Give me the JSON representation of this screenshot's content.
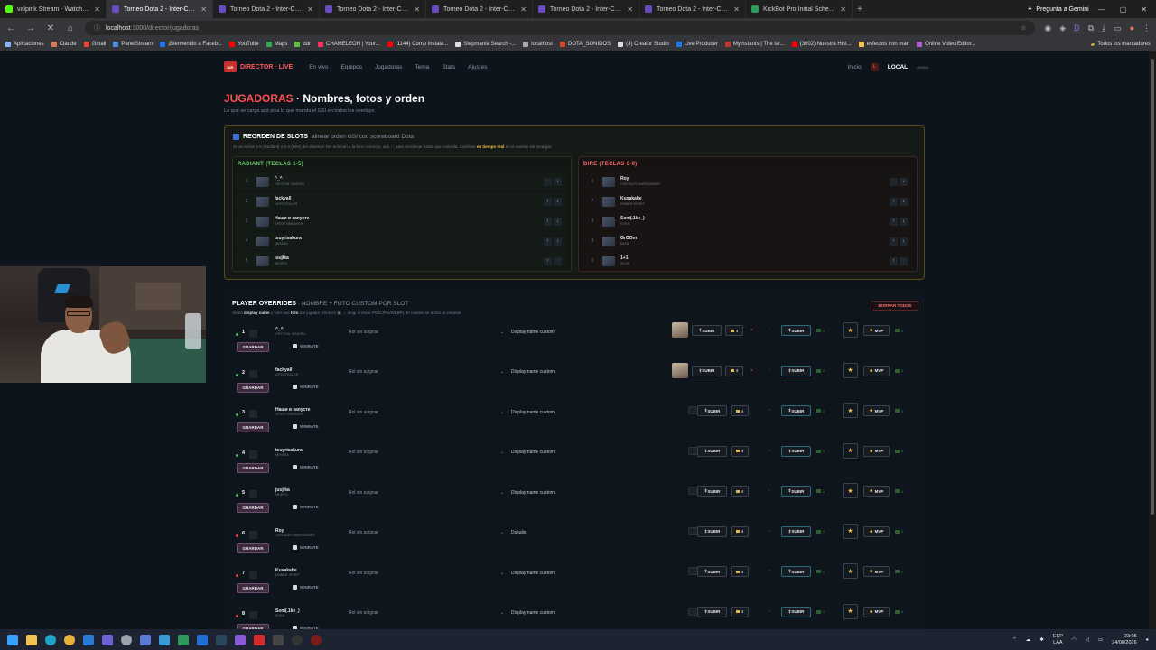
{
  "browser": {
    "tabs": [
      {
        "title": "valpink Stream - Watch Live",
        "fav": "#53fc18",
        "active": false
      },
      {
        "title": "Torneo Dota 2 - Inter-Comunid",
        "fav": "#6a4cc0",
        "active": true
      },
      {
        "title": "Torneo Dota 2 - Inter-Comunid",
        "fav": "#6a4cc0",
        "active": false
      },
      {
        "title": "Torneo Dota 2 - Inter-Comunid",
        "fav": "#6a4cc0",
        "active": false
      },
      {
        "title": "Torneo Dota 2 - Inter-Comunid",
        "fav": "#6a4cc0",
        "active": false
      },
      {
        "title": "Torneo Dota 2 - Inter-Comunid",
        "fav": "#6a4cc0",
        "active": false
      },
      {
        "title": "Torneo Dota 2 - Inter-Comunid",
        "fav": "#6a4cc0",
        "active": false
      },
      {
        "title": "KickBot Pro Initial Schema | SC",
        "fav": "#2e9a5e",
        "active": false
      }
    ],
    "gemini_label": "Pregunta a Gemini",
    "url_host": "localhost",
    "url_path": ":3000/director/jugadoras",
    "bookmarks": [
      {
        "label": "Aplicaciones",
        "color": "#8ab4f8"
      },
      {
        "label": "Claude",
        "color": "#d97757"
      },
      {
        "label": "Gmail",
        "color": "#ea4335"
      },
      {
        "label": "PanelStream",
        "color": "#4a90e2"
      },
      {
        "label": "¡Bienvenido a Faceb...",
        "color": "#1877f2"
      },
      {
        "label": "YouTube",
        "color": "#ff0000"
      },
      {
        "label": "Maps",
        "color": "#34a853"
      },
      {
        "label": "ddr",
        "color": "#5fbf3f"
      },
      {
        "label": "CHAMELEON | Your...",
        "color": "#ff3366"
      },
      {
        "label": "(1144) Como instala...",
        "color": "#ff0000"
      },
      {
        "label": "Stepmania Search -...",
        "color": "#dddddd"
      },
      {
        "label": "localhost",
        "color": "#aaaaaa"
      },
      {
        "label": "DOTA_SONIDOS",
        "color": "#d04a2a"
      },
      {
        "label": "(3) Creator Studio",
        "color": "#dddddd"
      },
      {
        "label": "Live Producer",
        "color": "#1877f2"
      },
      {
        "label": "Myinstants | The lar...",
        "color": "#c0392b"
      },
      {
        "label": "(3002) Nuestra Hist...",
        "color": "#ff0000"
      },
      {
        "label": "evfectos iron man",
        "color": "#f2c14e"
      },
      {
        "label": "Online Video Editor...",
        "color": "#b45fd6"
      }
    ],
    "bookmarks_all": "Todos los marcadores"
  },
  "app": {
    "brand": "DIRECTOR · LIVE",
    "nav": [
      "En vivo",
      "Equipos",
      "Jugadoras",
      "Tema",
      "Stats",
      "Ajustes"
    ],
    "inicio": "Inicio",
    "local_badge": "L",
    "local": "LOCAL",
    "admin": "ADMIN"
  },
  "header": {
    "title_red": "JUGADORAS",
    "title_rest": "· Nombres, fotos y orden",
    "subtitle": "Lo que se carga acá pisa lo que manda el GSI en todos los overlays."
  },
  "reorder": {
    "title": "REORDEN DE SLOTS",
    "note": "alinear orden GSI con scoreboard Dota",
    "desc_a": "Si las teclas 1-5 (Radiant) o 6-0 (Dire) del observer NO enfocan a la hero correcto, usá ↑↓ para reordenar hasta que coincida. Cambios",
    "desc_b": "en tiempo real",
    "desc_c": "en el overlay sin recargar.",
    "radiant_title": "RADIANT (TECLAS 1-5)",
    "dire_title": "DIRE (TECLAS 6-0)",
    "radiant": [
      {
        "n": "1",
        "player": "^_^",
        "hero": "CRYSTAL MAIDEN",
        "up": false,
        "down": true
      },
      {
        "n": "2",
        "player": "fackyall",
        "hero": "LIFESTEALER",
        "up": true,
        "down": true
      },
      {
        "n": "3",
        "player": "Наши в капусте",
        "hero": "SPIRIT BREAKER",
        "up": true,
        "down": true
      },
      {
        "n": "4",
        "player": "tsuyrisakura",
        "hero": "MIRANA",
        "up": true,
        "down": true
      },
      {
        "n": "5",
        "player": "juujika",
        "hero": "MEEPO",
        "up": true,
        "down": false
      }
    ],
    "dire": [
      {
        "n": "6",
        "player": "Roy",
        "hero": "CENTAUR WARRUNNER",
        "up": false,
        "down": true
      },
      {
        "n": "7",
        "player": "Kusakabe",
        "hero": "EMBER SPIRIT",
        "up": true,
        "down": true
      },
      {
        "n": "8",
        "player": "Soni(.1ke_)",
        "hero": "SVEN",
        "up": true,
        "down": true
      },
      {
        "n": "9",
        "player": "GrOOm",
        "hero": "BANE",
        "up": true,
        "down": true
      },
      {
        "n": "0",
        "player": "1+1",
        "hero": "ZEUS",
        "up": true,
        "down": false
      }
    ]
  },
  "overrides": {
    "title": "PLAYER OVERRIDES",
    "subtitle": "· NOMBRE + FOTO CUSTOM POR SLOT",
    "desc_a": "Setéá",
    "desc_b": "display name",
    "desc_c": "y subí una",
    "desc_d": "foto",
    "desc_e": "por jugador (click en",
    "desc_f": "→ elegí archivo PNG/JPG/WEBP). El cambio se aplica al instante.",
    "clear_all": "BORRAR TODOS",
    "role_placeholder": "Rol sin asignar",
    "display_placeholder": "Display name custom",
    "subir": "SUBIR",
    "count": "4",
    "mvp": "MVP",
    "zero": "0",
    "guardar": "GUARDAR",
    "winrate": "WINRATE",
    "rows": [
      {
        "slot": "1",
        "player": "^_^",
        "hero": "CRYSTAL MAIDEN",
        "display": "",
        "photo": true,
        "team": "radiant"
      },
      {
        "slot": "2",
        "player": "fackyall",
        "hero": "LIFESTEALER",
        "display": "",
        "photo": true,
        "team": "radiant"
      },
      {
        "slot": "3",
        "player": "Наши в капусте",
        "hero": "SPIRIT BREAKER",
        "display": "",
        "photo": false,
        "team": "radiant"
      },
      {
        "slot": "4",
        "player": "tsuyrisakura",
        "hero": "MIRANA",
        "display": "",
        "photo": false,
        "team": "radiant"
      },
      {
        "slot": "5",
        "player": "juujika",
        "hero": "MEEPO",
        "display": "",
        "photo": false,
        "team": "radiant"
      },
      {
        "slot": "6",
        "player": "Roy",
        "hero": "CENTAUR WARRUNNER",
        "display": "Dukalis",
        "photo": false,
        "team": "dire"
      },
      {
        "slot": "7",
        "player": "Kusakabe",
        "hero": "EMBER SPIRIT",
        "display": "",
        "photo": false,
        "team": "dire"
      },
      {
        "slot": "8",
        "player": "Soni(.1ke_)",
        "hero": "SVEN",
        "display": "",
        "photo": false,
        "team": "dire"
      }
    ]
  },
  "taskbar": {
    "lang_a": "ESP",
    "lang_b": "LAA",
    "time": "23:05",
    "date": "24/08/2026"
  },
  "colors": {
    "radiant": "#3fbf5f",
    "dire": "#e04545",
    "accent_red": "#ff4d4d",
    "gold": "#f2c14e"
  }
}
